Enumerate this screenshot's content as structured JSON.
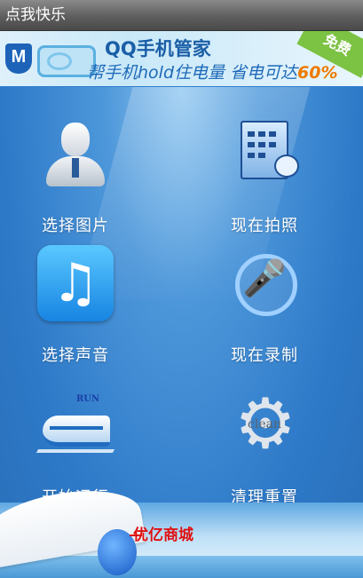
{
  "app": {
    "title": "点我快乐"
  },
  "banner": {
    "brand_icon": "M",
    "title": "QQ手机管家",
    "subtitle": "帮手机hold住电量 省电可达",
    "highlight": "60%",
    "badge": "免费"
  },
  "grid": {
    "items": [
      {
        "label": "选择图片",
        "icon": "user-icon"
      },
      {
        "label": "现在拍照",
        "icon": "building-icon"
      },
      {
        "label": "选择声音",
        "icon": "music-icon"
      },
      {
        "label": "现在录制",
        "icon": "microphone-icon"
      },
      {
        "label": "开始运行",
        "icon": "train-icon",
        "icon_text": "RUN"
      },
      {
        "label": "清理重置",
        "icon": "gear-icon",
        "icon_text": "clean"
      }
    ]
  },
  "footer": {
    "shop_label": "优亿商城"
  },
  "colors": {
    "accent": "#2f7fd0",
    "banner_highlight": "#ee7a00",
    "shop_text": "#e01010"
  }
}
